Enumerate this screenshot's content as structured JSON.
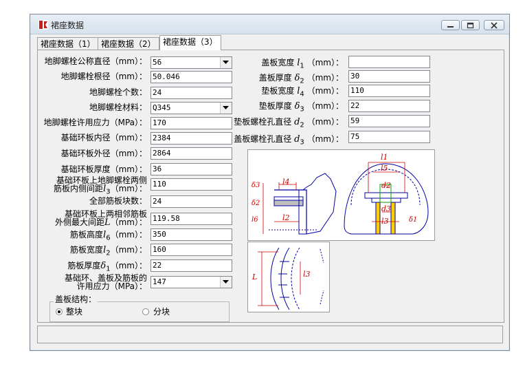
{
  "window": {
    "title": "裙座数据"
  },
  "tabs": [
    {
      "label": "裙座数据（1）",
      "active": false
    },
    {
      "label": "裙座数据（2）",
      "active": false
    },
    {
      "label": "裙座数据（3）",
      "active": true
    }
  ],
  "left_fields": {
    "bolt_diameter": {
      "label": "地脚螺栓公称直径（mm）：",
      "value": "56"
    },
    "bolt_root": {
      "label": "地脚螺栓根径（mm）：",
      "value": "50.046"
    },
    "bolt_count": {
      "label": "地脚螺栓个数：",
      "value": "24"
    },
    "bolt_material": {
      "label": "地脚螺栓材料：",
      "value": "Q345"
    },
    "bolt_stress": {
      "label": "地脚螺栓许用应力（MPa）：",
      "value": "170"
    },
    "ring_inner": {
      "label": "基础环板内径（mm）：",
      "value": "2384"
    },
    "ring_outer": {
      "label": "基础环板外径（mm）：",
      "value": "2864"
    },
    "ring_thickness": {
      "label": "基础环板厚度（mm）：",
      "value": "36"
    },
    "rib_spacing": {
      "label_line1": "基础环板上地脚螺栓两侧",
      "label_line2a": "筋板内侧间距",
      "label_symbol": "l",
      "label_sub": "3",
      "label_line2b": "（mm）：",
      "value": "110"
    },
    "rib_count": {
      "label": "全部筋板块数：",
      "value": "24"
    },
    "rib_max_dist": {
      "label_line1": "基础环板上两相邻筋板",
      "label_line2a": "外侧最大间距",
      "label_symbol": "L",
      "label_line2b": "（mm）：",
      "value": "119.58"
    },
    "rib_height": {
      "label_a": "筋板高度",
      "label_symbol": "l",
      "label_sub": "6",
      "label_b": "（mm）：",
      "value": "350"
    },
    "rib_width": {
      "label_a": "筋板宽度",
      "label_symbol": "l",
      "label_sub": "2",
      "label_b": "（mm）：",
      "value": "160"
    },
    "rib_thickness": {
      "label_a": "筋板厚度",
      "label_symbol": "δ",
      "label_sub": "1",
      "label_b": "（mm）：",
      "value": "22"
    },
    "allow_stress": {
      "label_line1": "基础环、盖板及筋板的",
      "label_line2": "许用应力（MPa）：",
      "value": "147"
    }
  },
  "cover_structure": {
    "title": "盖板结构：",
    "options": [
      {
        "label": "整块",
        "selected": true
      },
      {
        "label": "分块",
        "selected": false
      }
    ]
  },
  "right_fields": {
    "cover_width": {
      "label_a": "盖板宽度",
      "label_symbol": "l",
      "label_sub": "1",
      "label_b": "（mm）：",
      "value": ""
    },
    "cover_thickness": {
      "label_a": "盖板厚度",
      "label_symbol": "δ",
      "label_sub": "2",
      "label_b": "（mm）：",
      "value": "30"
    },
    "pad_width": {
      "label_a": "垫板宽度",
      "label_symbol": "l",
      "label_sub": "4",
      "label_b": "（mm）：",
      "value": "110"
    },
    "pad_thickness": {
      "label_a": "垫板厚度",
      "label_symbol": "δ",
      "label_sub": "3",
      "label_b": "（mm）：",
      "value": "22"
    },
    "pad_hole": {
      "label_a": "垫板螺栓孔直径",
      "label_symbol": "d",
      "label_sub": "2",
      "label_b": "（mm）：",
      "value": "59"
    },
    "cover_hole": {
      "label_a": "盖板螺栓孔直径",
      "label_symbol": "d",
      "label_sub": "3",
      "label_b": "（mm）：",
      "value": "75"
    }
  },
  "diagram_labels": {
    "d3": "δ3",
    "d2": "δ2",
    "l4": "l4",
    "l6": "l6",
    "l2": "l2",
    "l1": "l1",
    "l5": "l5",
    "dd2": "d2",
    "dd3": "d3",
    "l3": "l3",
    "d1": "δ1",
    "L": "L",
    "l3b": "l3"
  },
  "colors": {
    "window_bg": "#f0f0f0",
    "diagram_line": "#0000a0",
    "dim_red": "#cc0000",
    "highlight_green": "#00a000"
  }
}
